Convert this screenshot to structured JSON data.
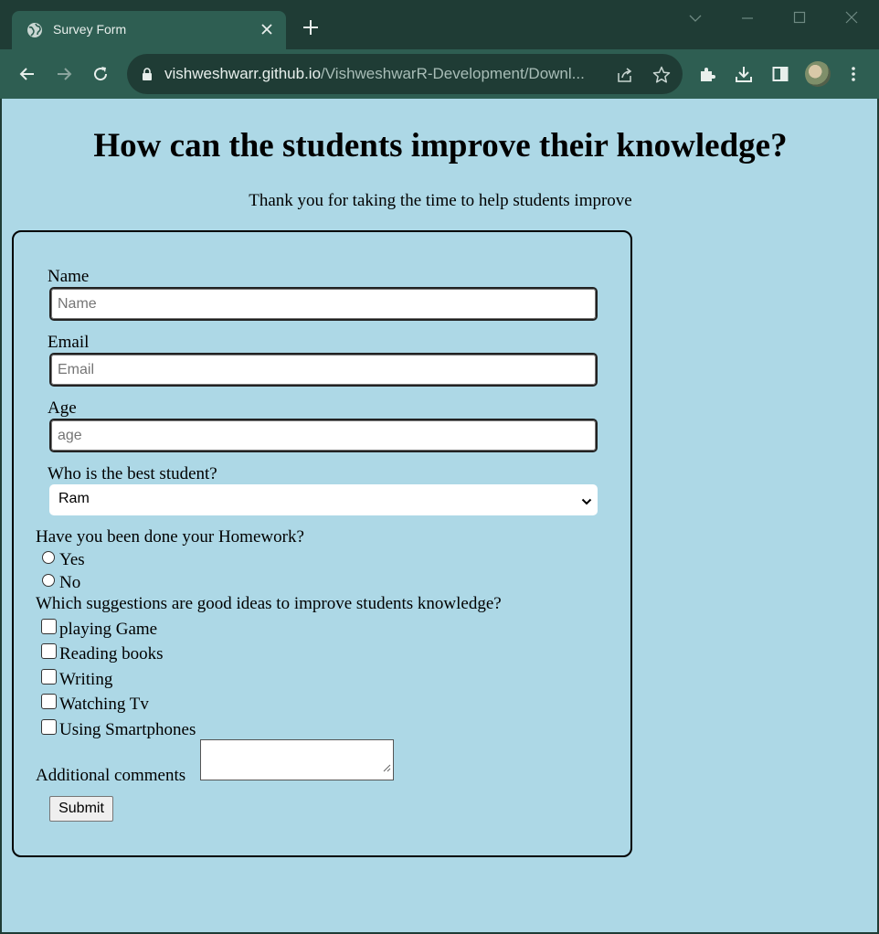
{
  "browser": {
    "tab_title": "Survey Form",
    "url_host": "vishweshwarr.github.io",
    "url_path": "/VishweshwarR-Development/Downl...",
    "icons": {
      "tab": "globe-icon",
      "close": "close-icon",
      "new_tab": "plus-icon",
      "back": "back-arrow-icon",
      "forward": "forward-arrow-icon",
      "reload": "reload-icon",
      "lock": "lock-icon",
      "share": "share-icon",
      "bookmark": "star-icon",
      "extensions": "puzzle-icon",
      "downloads": "download-icon",
      "side_panel": "side-panel-icon",
      "menu": "kebab-menu-icon"
    },
    "colors": {
      "frame": "#1f3c35",
      "toolbar": "#2e5e52"
    }
  },
  "page": {
    "title": "How can the students improve their knowledge?",
    "description": "Thank you for taking the time to help students improve",
    "background": "#add8e6"
  },
  "form": {
    "name": {
      "label": "Name",
      "placeholder": "Name"
    },
    "email": {
      "label": "Email",
      "placeholder": "Email"
    },
    "age": {
      "label": "Age",
      "placeholder": "age"
    },
    "best_student": {
      "label": "Who is the best student?",
      "selected": "Ram"
    },
    "homework": {
      "question": "Have you been done your Homework?",
      "options": [
        "Yes",
        "No"
      ]
    },
    "suggestions": {
      "question": "Which suggestions are good ideas to improve students knowledge?",
      "options": [
        "playing Game",
        "Reading books",
        "Writing",
        "Watching Tv",
        "Using Smartphones"
      ]
    },
    "comments_label": "Additional comments",
    "submit_label": "Submit"
  }
}
